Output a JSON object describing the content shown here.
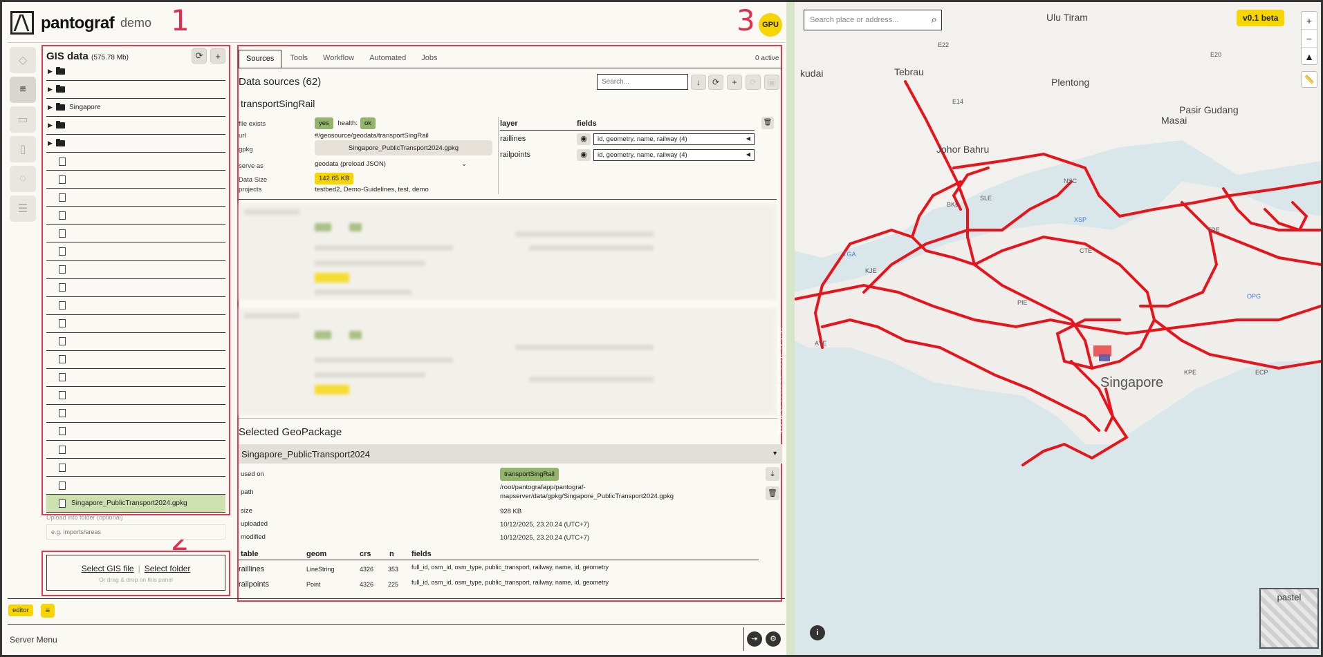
{
  "header": {
    "brand": "pantograf",
    "brand_sub": "demo",
    "gpu": "GPU"
  },
  "annotations": [
    "1",
    "2",
    "3"
  ],
  "gis": {
    "title": "GIS data",
    "size": "(575.78 Mb)",
    "tree": [
      {
        "type": "folder",
        "label": ""
      },
      {
        "type": "folder",
        "label": ""
      },
      {
        "type": "folder",
        "label": "Singapore"
      },
      {
        "type": "folder",
        "label": ""
      },
      {
        "type": "folder",
        "label": ""
      },
      {
        "type": "file",
        "label": ""
      },
      {
        "type": "file",
        "label": ""
      },
      {
        "type": "file",
        "label": ""
      },
      {
        "type": "file",
        "label": ""
      },
      {
        "type": "file",
        "label": ""
      },
      {
        "type": "file",
        "label": ""
      },
      {
        "type": "file",
        "label": ""
      },
      {
        "type": "file",
        "label": ""
      },
      {
        "type": "file",
        "label": ""
      },
      {
        "type": "file",
        "label": ""
      },
      {
        "type": "file",
        "label": ""
      },
      {
        "type": "file",
        "label": ""
      },
      {
        "type": "file",
        "label": ""
      },
      {
        "type": "file",
        "label": ""
      },
      {
        "type": "file",
        "label": ""
      },
      {
        "type": "file",
        "label": ""
      },
      {
        "type": "file",
        "label": ""
      },
      {
        "type": "file",
        "label": ""
      },
      {
        "type": "file",
        "label": ""
      },
      {
        "type": "file",
        "label": "Singapore_PublicTransport2024.gpkg",
        "selected": true
      }
    ],
    "upload_label": "Upload into folder (optional)",
    "upload_placeholder": "e.g. imports/areas",
    "select_file": "Select GIS file",
    "select_folder": "Select folder",
    "sep": "|",
    "drop_hint": "Or drag & drop on this panel"
  },
  "tabs": [
    "Sources",
    "Tools",
    "Workflow",
    "Automated",
    "Jobs"
  ],
  "active_count": "0 active",
  "sources": {
    "title": "Data sources (62)",
    "search_placeholder": "Search...",
    "name": "transportSingRail",
    "labels": {
      "file_exists": "file exists",
      "health": "health:",
      "url": "url",
      "gpkg": "gpkg",
      "serve_as": "serve as",
      "data_size": "Data Size",
      "projects": "projects"
    },
    "file_exists": "yes",
    "health": "ok",
    "url": "#/geosource/geodata/transportSingRail",
    "gpkg": "Singapore_PublicTransport2024.gpkg",
    "serve_as": "geodata (preload JSON)",
    "data_size": "142.65 KB",
    "projects": "testbed2, Demo-Guidelines, test, demo",
    "layer_header": "layer",
    "fields_header": "fields",
    "layers": [
      {
        "name": "raillines",
        "fields": "id, geometry, name, railway (4)"
      },
      {
        "name": "railpoints",
        "fields": "id, geometry, name, railway (4)"
      }
    ]
  },
  "geopackage": {
    "title": "Selected GeoPackage",
    "name": "Singapore_PublicTransport2024",
    "labels": {
      "used_on": "used on",
      "path": "path",
      "size": "size",
      "uploaded": "uploaded",
      "modified": "modified"
    },
    "used_on": "transportSingRail",
    "path": "/root/pantografapp/pantograf-mapserver/data/gpkg/Singapore_PublicTransport2024.gpkg",
    "size": "928 KB",
    "uploaded": "10/12/2025, 23.20.24 (UTC+7)",
    "modified": "10/12/2025, 23.20.24 (UTC+7)",
    "table_headers": [
      "table",
      "geom",
      "crs",
      "n",
      "fields"
    ],
    "tables": [
      {
        "table": "raillines",
        "geom": "LineString",
        "crs": "4326",
        "n": "353",
        "fields": "full_id, osm_id, osm_type, public_transport, railway, name, id, geometry"
      },
      {
        "table": "railpoints",
        "geom": "Point",
        "crs": "4326",
        "n": "225",
        "fields": "full_id, osm_id, osm_type, public_transport, railway, name, id, geometry"
      }
    ]
  },
  "footer": {
    "editor": "editor",
    "server_menu": "Server Menu"
  },
  "divider_text": "click to close, or press shift+tab",
  "map": {
    "search_placeholder": "Search place or address...",
    "beta": "v0.1 beta",
    "basemap": "pastel",
    "labels": {
      "ulu_tiram": "Ulu Tiram",
      "skudai": "kudai",
      "tebrau": "Tebrau",
      "plentong": "Plentong",
      "pasir_gudang": "Pasir Gudang",
      "masai": "Masai",
      "johor_bahru": "Johor Bahru",
      "singapore": "Singapore",
      "e22": "E22",
      "e14": "E14",
      "e20": "E20",
      "nsc": "NSC",
      "sle": "SLE",
      "bke": "BKE",
      "xsp": "XSP",
      "tpe": "TPE",
      "cte": "CTE",
      "kje": "KJE",
      "pie": "PIE",
      "aye": "AYE",
      "ecp": "ECP",
      "kpe": "KPE",
      "opg": "OPG",
      "tga": "TGA"
    }
  },
  "colors": {
    "accent": "#f6d500",
    "rail": "#e8141b",
    "green": "#93b46b",
    "annotation": "#e8384f"
  }
}
